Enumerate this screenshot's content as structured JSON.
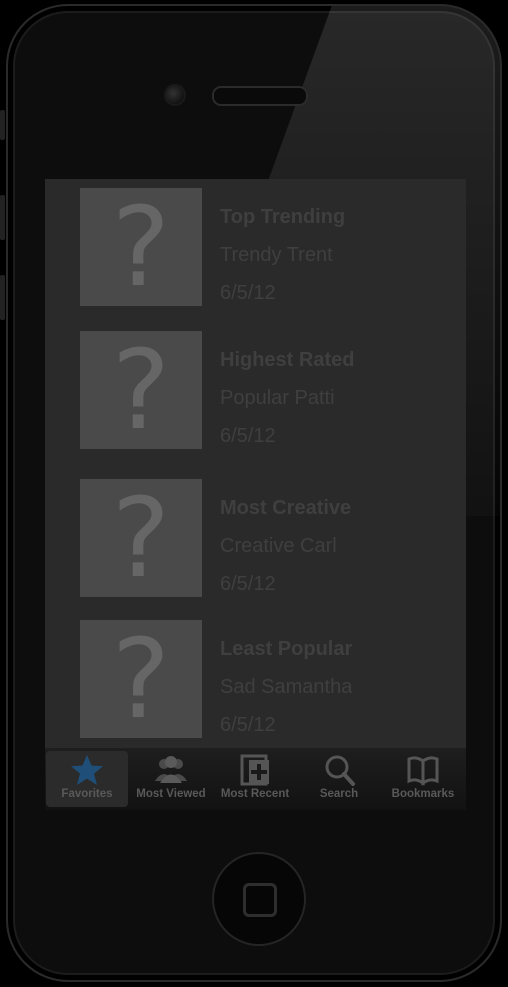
{
  "items": [
    {
      "title": "Top Trending",
      "subtitle": "Trendy Trent",
      "date": "6/5/12",
      "thumb": "?"
    },
    {
      "title": "Highest Rated",
      "subtitle": "Popular Patti",
      "date": "6/5/12",
      "thumb": "?"
    },
    {
      "title": "Most Creative",
      "subtitle": "Creative Carl",
      "date": "6/5/12",
      "thumb": "?"
    },
    {
      "title": "Least Popular",
      "subtitle": "Sad Samantha",
      "date": "6/5/12",
      "thumb": "?"
    }
  ],
  "tabs": [
    {
      "label": "Favorites",
      "icon": "star-icon",
      "selected": true
    },
    {
      "label": "Most Viewed",
      "icon": "people-icon",
      "selected": false
    },
    {
      "label": "Most Recent",
      "icon": "plus-page-icon",
      "selected": false
    },
    {
      "label": "Search",
      "icon": "magnifier-icon",
      "selected": false
    },
    {
      "label": "Bookmarks",
      "icon": "book-icon",
      "selected": false
    }
  ],
  "colors": {
    "accent": "#1f4f78",
    "tab_label": "#595959",
    "overlay": "#2a2a2a"
  }
}
